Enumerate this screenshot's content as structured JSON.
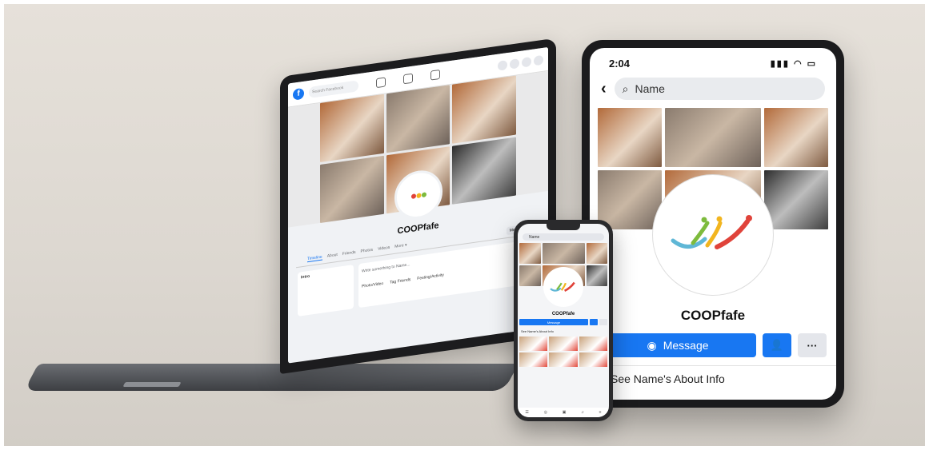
{
  "laptop": {
    "search_placeholder": "Search Facebook",
    "page_name": "COOPfafe",
    "tabs": [
      "Timeline",
      "About",
      "Friends",
      "Photos",
      "Videos",
      "More ▾"
    ],
    "message_label": "Message",
    "intro_label": "Intro",
    "composer_placeholder": "Write something to Name...",
    "composer_actions": [
      "Photo/Video",
      "Tag Friends",
      "Feeling/Activity"
    ]
  },
  "tablet": {
    "time": "2:04",
    "status_icons": "▮▮▮ ◠ ▭",
    "search_text": "Name",
    "page_name": "COOPfafe",
    "message_label": "Message",
    "about_label": "See Name's About Info"
  },
  "phone": {
    "search_text": "Name",
    "page_name": "COOPfafe",
    "message_label": "Message",
    "about_label": "See Name's About Info",
    "nav_icons": [
      "☰",
      "◎",
      "▣",
      "♫",
      "≡"
    ]
  },
  "logo_swirl": "〰︎",
  "colors": {
    "fb_blue": "#1877f2",
    "background": "#e2ddd6"
  }
}
